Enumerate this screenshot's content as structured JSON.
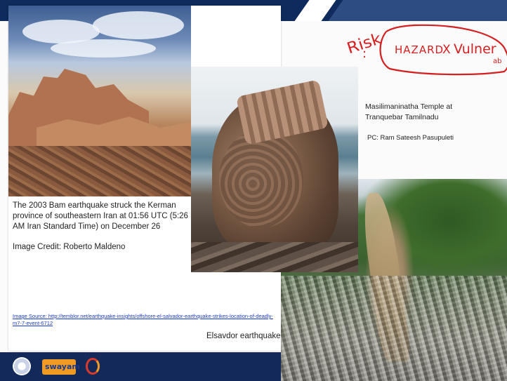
{
  "bam": {
    "caption": "The 2003 Bam earthquake struck the Kerman province of southeastern Iran at 01:56 UTC (5:26 AM Iran Standard Time) on December 26",
    "credit": "Image Credit: Roberto Maldeno",
    "source": "Image Source: http://temblor.net/earthquake-insights/offshore-el-salvador-earthquake-strikes-location-of-deadly-m7-7-event-6712",
    "eq_label": "Elsavdor earthquake"
  },
  "temple": {
    "label": "Masilimaninatha Temple at Tranquebar Tamilnadu",
    "credit": "PC: Ram Sateesh Pasupuleti"
  },
  "annotation": {
    "risk": "Risk",
    "colon": ":",
    "formula": "HAZARD",
    "times": "X",
    "vulner": "Vulner",
    "ab": "ab"
  },
  "logos": {
    "swayam": "swayam"
  },
  "colors": {
    "band": "#0f2a5c",
    "ink": "#d42020",
    "link": "#1a3cc8"
  }
}
